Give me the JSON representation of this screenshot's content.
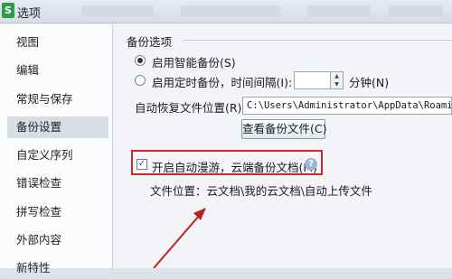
{
  "window": {
    "title": "选项",
    "app_icon_letter": "S"
  },
  "sidebar": {
    "items": [
      {
        "label": "视图"
      },
      {
        "label": "编辑"
      },
      {
        "label": "常规与保存"
      },
      {
        "label": "备份设置",
        "selected": true
      },
      {
        "label": "自定义序列"
      },
      {
        "label": "错误检查"
      },
      {
        "label": "拼写检查"
      },
      {
        "label": "外部内容"
      },
      {
        "label": "新特性"
      }
    ]
  },
  "backup": {
    "group_title": "备份选项",
    "smart_backup_label": "启用智能备份(S)",
    "timed_backup_label": "启用定时备份，时间间隔(I):",
    "interval_value": "",
    "interval_unit": "分钟(N)",
    "autorecover_label": "自动恢复文件位置(R):",
    "autorecover_path": "C:\\Users\\Administrator\\AppData\\Roaming\\ki",
    "view_backup_button": "查看备份文件(C)",
    "auto_roam_label": "开启自动漫游，云端备份文档(M)",
    "auto_roam_checked": true,
    "file_location_text": "文件位置：云文档\\我的云文档\\自动上传文件"
  },
  "colors": {
    "highlight": "#d02828",
    "selected_item_bg": "#d7dde5",
    "icon_green": "#2d9b4a"
  }
}
